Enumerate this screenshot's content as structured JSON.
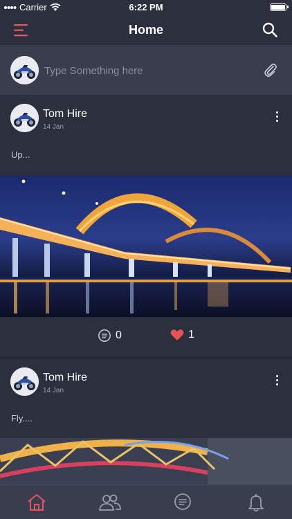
{
  "status_bar": {
    "carrier": "Carrier",
    "time": "6:22 PM"
  },
  "header": {
    "title": "Home"
  },
  "composer": {
    "placeholder": "Type Something here"
  },
  "posts": [
    {
      "author": "Tom Hire",
      "date": "14 Jan",
      "text": "Up...",
      "comments": "0",
      "likes": "1"
    },
    {
      "author": "Tom Hire",
      "date": "14 Jan",
      "text": "Fly...."
    }
  ],
  "tabs": [
    "home-icon",
    "friends-icon",
    "messages-icon",
    "notifications-icon"
  ],
  "colors": {
    "accent": "#e8525b",
    "background": "#2c2f3e",
    "panel": "#3a3d4d"
  }
}
